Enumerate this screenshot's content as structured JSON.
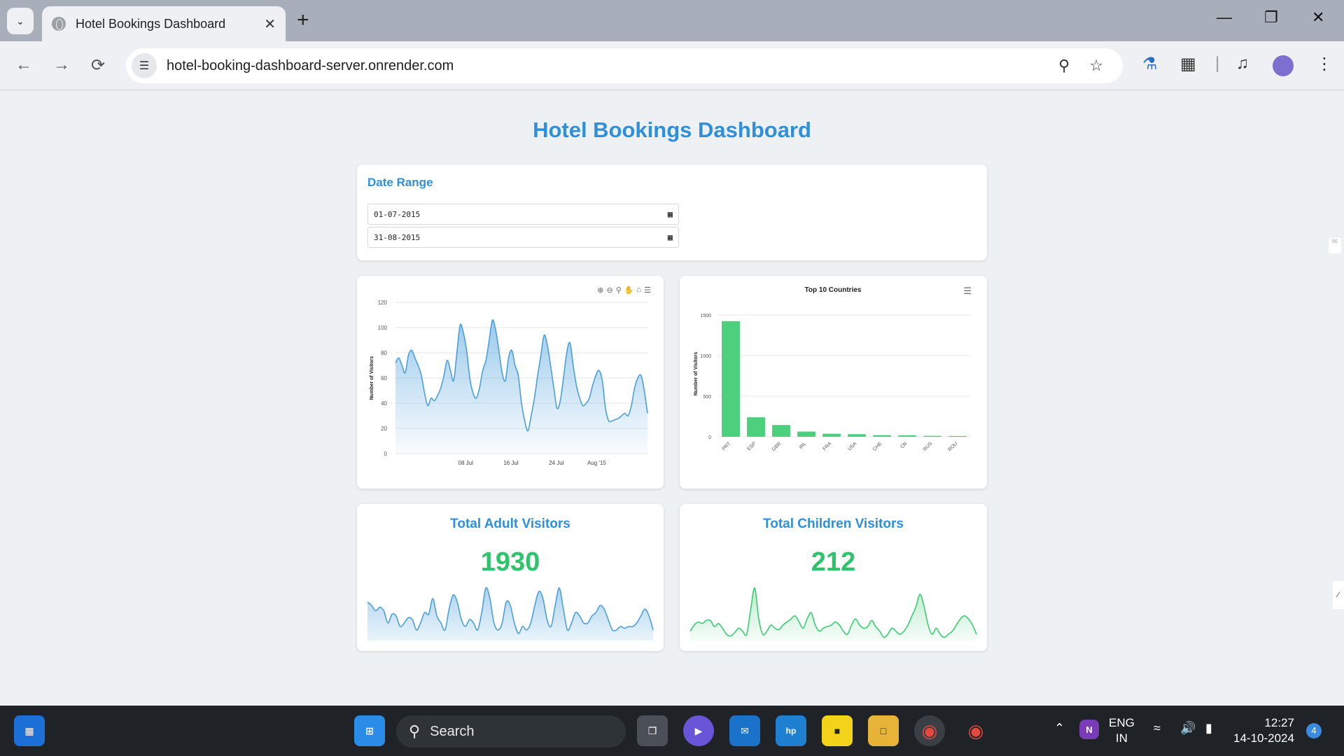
{
  "browser": {
    "tab_title": "Hotel Bookings Dashboard",
    "url": "hotel-booking-dashboard-server.onrender.com"
  },
  "dashboard": {
    "title": "Hotel Bookings Dashboard",
    "date_range": {
      "heading": "Date Range",
      "start": "01-07-2015",
      "end": "31-08-2015"
    },
    "adult": {
      "title": "Total Adult Visitors",
      "value": "1930"
    },
    "children": {
      "title": "Total Children Visitors",
      "value": "212"
    }
  },
  "chart_data": [
    {
      "type": "area",
      "title": "",
      "xlabel": "",
      "ylabel": "Number of Visitors",
      "ylim": [
        0,
        120
      ],
      "yticks": [
        "0",
        "20",
        "40",
        "60",
        "80",
        "100",
        "120"
      ],
      "xticks": [
        "08 Jul",
        "16 Jul",
        "24 Jul",
        "Aug '15"
      ],
      "color": "#4a9fdc",
      "values": [
        72,
        76,
        70,
        64,
        78,
        82,
        76,
        70,
        62,
        48,
        38,
        44,
        42,
        46,
        52,
        62,
        74,
        66,
        58,
        80,
        102,
        96,
        82,
        60,
        48,
        44,
        52,
        66,
        74,
        90,
        106,
        98,
        82,
        64,
        58,
        76,
        82,
        70,
        62,
        40,
        26,
        18,
        30,
        44,
        62,
        78,
        94,
        86,
        70,
        52,
        36,
        42,
        60,
        80,
        88,
        70,
        54,
        44,
        38,
        40,
        44,
        54,
        62,
        66,
        58,
        36,
        26,
        26,
        27,
        28,
        30,
        32,
        30,
        38,
        52,
        60,
        62,
        50,
        32
      ]
    },
    {
      "type": "bar",
      "title": "Top 10 Countries",
      "xlabel": "",
      "ylabel": "Number of Visitors",
      "ylim": [
        0,
        1500
      ],
      "yticks": [
        "0",
        "500",
        "1000",
        "1500"
      ],
      "color": "#4cd07d",
      "categories": [
        "PRT",
        "ESP",
        "GBR",
        "IRL",
        "FRA",
        "USA",
        "CHE",
        "CN",
        "RUS",
        "ROU"
      ],
      "values": [
        1425,
        240,
        145,
        65,
        38,
        32,
        20,
        18,
        12,
        10
      ]
    },
    {
      "type": "area",
      "title": "",
      "color": "#4a9fdc",
      "values": [
        22,
        20,
        17,
        19,
        17,
        10,
        15,
        14,
        8,
        10,
        13,
        12,
        6,
        10,
        16,
        15,
        24,
        14,
        10,
        6,
        18,
        26,
        22,
        12,
        8,
        12,
        10,
        6,
        16,
        30,
        24,
        10,
        6,
        10,
        22,
        20,
        10,
        4,
        8,
        6,
        10,
        20,
        28,
        24,
        12,
        8,
        20,
        30,
        18,
        6,
        10,
        16,
        14,
        10,
        10,
        14,
        16,
        20,
        18,
        12,
        6,
        6,
        8,
        7,
        8,
        8,
        10,
        14,
        18,
        14,
        6
      ]
    },
    {
      "type": "area",
      "title": "",
      "color": "#3ccb72",
      "values": [
        6,
        10,
        12,
        11,
        13,
        13,
        9,
        11,
        8,
        4,
        3,
        5,
        8,
        6,
        4,
        20,
        34,
        14,
        4,
        6,
        10,
        8,
        7,
        10,
        12,
        14,
        16,
        12,
        8,
        14,
        18,
        10,
        6,
        8,
        9,
        10,
        12,
        10,
        6,
        4,
        10,
        14,
        10,
        8,
        9,
        13,
        9,
        6,
        2,
        4,
        8,
        6,
        4,
        6,
        10,
        16,
        22,
        30,
        22,
        10,
        4,
        8,
        4,
        2,
        4,
        6,
        10,
        14,
        16,
        14,
        10,
        4
      ]
    }
  ],
  "taskbar": {
    "search_label": "Search",
    "lang_top": "ENG",
    "lang_bottom": "IN",
    "time": "12:27",
    "date": "14-10-2024",
    "notif_count": "4"
  }
}
